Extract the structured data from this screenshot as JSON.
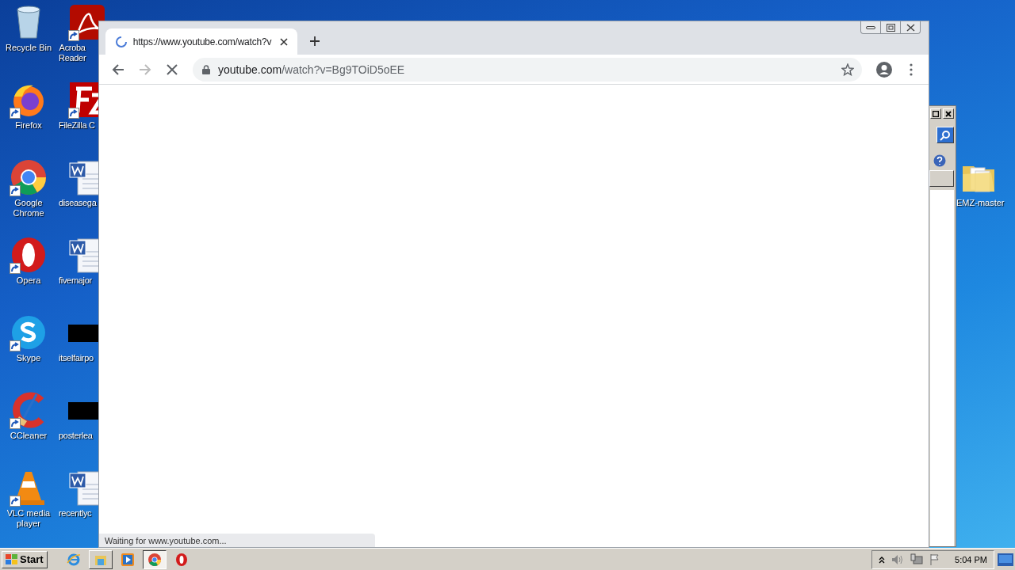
{
  "desktop": {
    "icon_columns": [
      {
        "icons": [
          {
            "lines": [
              "Recycle Bin"
            ],
            "kind": "recycle",
            "shortcut": false
          },
          {
            "lines": [
              "Firefox"
            ],
            "kind": "firefox",
            "shortcut": true
          },
          {
            "lines": [
              "Google",
              "Chrome"
            ],
            "kind": "chrome",
            "shortcut": true
          },
          {
            "lines": [
              "Opera"
            ],
            "kind": "opera",
            "shortcut": true
          },
          {
            "lines": [
              "Skype"
            ],
            "kind": "skype",
            "shortcut": true
          },
          {
            "lines": [
              "CCleaner"
            ],
            "kind": "ccleaner",
            "shortcut": true
          },
          {
            "lines": [
              "VLC media",
              "player"
            ],
            "kind": "vlc",
            "shortcut": true
          }
        ]
      },
      {
        "icons": [
          {
            "lines": [
              "Acroba",
              "Reader"
            ],
            "kind": "acrobat",
            "shortcut": true
          },
          {
            "lines": [
              "FileZilla C"
            ],
            "kind": "filezilla",
            "shortcut": true
          },
          {
            "lines": [
              "diseasega"
            ],
            "kind": "word",
            "shortcut": false
          },
          {
            "lines": [
              "fivemajor"
            ],
            "kind": "word",
            "shortcut": false
          },
          {
            "lines": [
              "itselfairpo"
            ],
            "kind": "thumb",
            "shortcut": false
          },
          {
            "lines": [
              "posterlea"
            ],
            "kind": "thumb",
            "shortcut": false
          },
          {
            "lines": [
              "recentlyc"
            ],
            "kind": "word",
            "shortcut": false
          }
        ]
      }
    ],
    "right_icon": {
      "lines": [
        "EMZ-master"
      ],
      "kind": "folder",
      "shortcut": false
    }
  },
  "browser": {
    "tabs": [
      {
        "title": "https://www.youtube.com/watch?v",
        "selected": true,
        "loading": true
      }
    ],
    "toolbar": {
      "back_disabled": false,
      "forward_disabled": true,
      "loading": true
    },
    "address": {
      "host": "youtube.com",
      "path": "/watch?v=Bg9TOiD5oEE"
    },
    "status": "Waiting for www.youtube.com..."
  },
  "taskbar": {
    "start": "Start",
    "apps": [
      {
        "kind": "ie",
        "running": false,
        "active": false
      },
      {
        "kind": "explorer",
        "running": true,
        "active": false
      },
      {
        "kind": "media",
        "running": false,
        "active": false
      },
      {
        "kind": "chrome",
        "running": true,
        "active": true
      },
      {
        "kind": "opera",
        "running": false,
        "active": false
      }
    ],
    "clock": "5:04 PM"
  }
}
